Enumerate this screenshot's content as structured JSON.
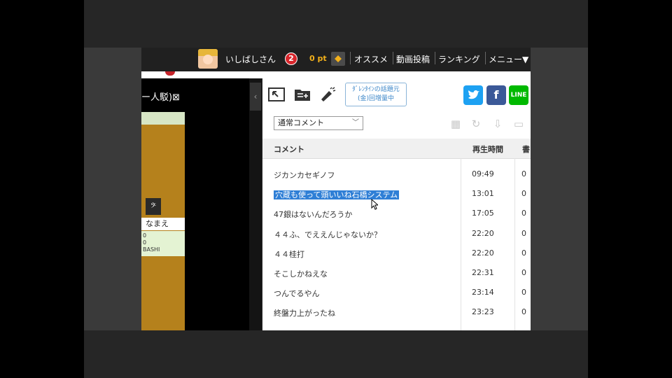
{
  "header": {
    "username": "いしばしさん",
    "notification_count": "2",
    "points": "0 pt",
    "nav": [
      "オススメ",
      "動画投稿",
      "ランキング",
      "メニュー▼"
    ]
  },
  "video": {
    "title_fragment": "ー人駁)⊠",
    "kana": "𝄢",
    "name_label": "なまえ",
    "info_lines": [
      "0",
      "0",
      "BASHI"
    ]
  },
  "panel": {
    "promo": [
      "ﾀﾞﾚﾝﾀｲﾝの話題元",
      "(金)回増量中"
    ],
    "sns": [
      "twitter",
      "facebook",
      "LINE"
    ],
    "comment_filter": "通常コメント",
    "columns": {
      "comment": "コメント",
      "time": "再生時間",
      "third": "書"
    },
    "rows": [
      {
        "comment": "ジカンカセギノフ",
        "time": "09:49",
        "num": "0"
      },
      {
        "comment": "穴蔵も使って頭いいね石橋システム",
        "time": "13:01",
        "num": "0",
        "selected": true
      },
      {
        "comment": "47銀はないんだろうか",
        "time": "17:05",
        "num": "0"
      },
      {
        "comment": "４４ふ、でええんじゃないか？",
        "time": "22:20",
        "num": "0"
      },
      {
        "comment": "４４桂打",
        "time": "22:20",
        "num": "0"
      },
      {
        "comment": "そこしかねえな",
        "time": "22:31",
        "num": "0"
      },
      {
        "comment": "つんでるやん",
        "time": "23:14",
        "num": "0"
      },
      {
        "comment": "終盤力上がったね",
        "time": "23:23",
        "num": "0"
      }
    ]
  },
  "colors": {
    "accent": "#2f7fd6",
    "board": "#b5811c",
    "twitter": "#1da1f2",
    "facebook": "#3b5998",
    "line": "#00b900"
  }
}
